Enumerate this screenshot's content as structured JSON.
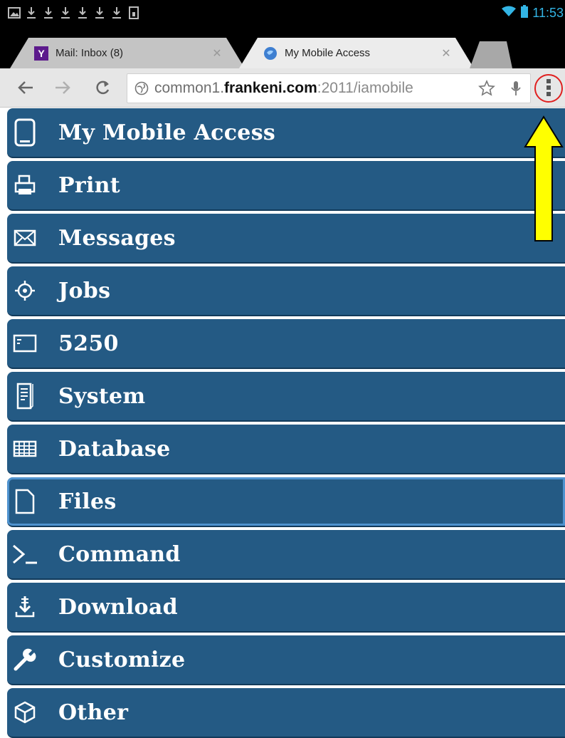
{
  "status_bar": {
    "notification_icons": [
      "image-icon",
      "download-icon",
      "download-icon",
      "download-icon",
      "download-icon",
      "download-icon",
      "download-icon",
      "sd-card-icon"
    ],
    "time": "11:53",
    "accent_color": "#33b5e5"
  },
  "tabs": [
    {
      "title": "Mail: Inbox (8)",
      "favicon": "yahoo-icon",
      "active": false
    },
    {
      "title": "My Mobile Access",
      "favicon": "globe-icon",
      "active": true
    }
  ],
  "toolbar": {
    "url_prefix": "common1.",
    "url_domain": "frankeni.com",
    "url_suffix": ":2011/iamobile"
  },
  "menu": {
    "item_color": "#245a84",
    "items": [
      {
        "label": "My Mobile Access",
        "icon": "tablet-icon"
      },
      {
        "label": "Print",
        "icon": "printer-icon"
      },
      {
        "label": "Messages",
        "icon": "envelope-icon"
      },
      {
        "label": "Jobs",
        "icon": "target-icon"
      },
      {
        "label": "5250",
        "icon": "terminal-window-icon"
      },
      {
        "label": "System",
        "icon": "server-icon"
      },
      {
        "label": "Database",
        "icon": "table-icon"
      },
      {
        "label": "Files",
        "icon": "file-icon",
        "selected": true
      },
      {
        "label": "Command",
        "icon": "command-prompt-icon"
      },
      {
        "label": "Download",
        "icon": "download-icon"
      },
      {
        "label": "Customize",
        "icon": "wrench-icon"
      },
      {
        "label": "Other",
        "icon": "cube-icon"
      }
    ]
  },
  "annotation": {
    "arrow_color": "#ffff00",
    "circle_color": "#e02020"
  }
}
